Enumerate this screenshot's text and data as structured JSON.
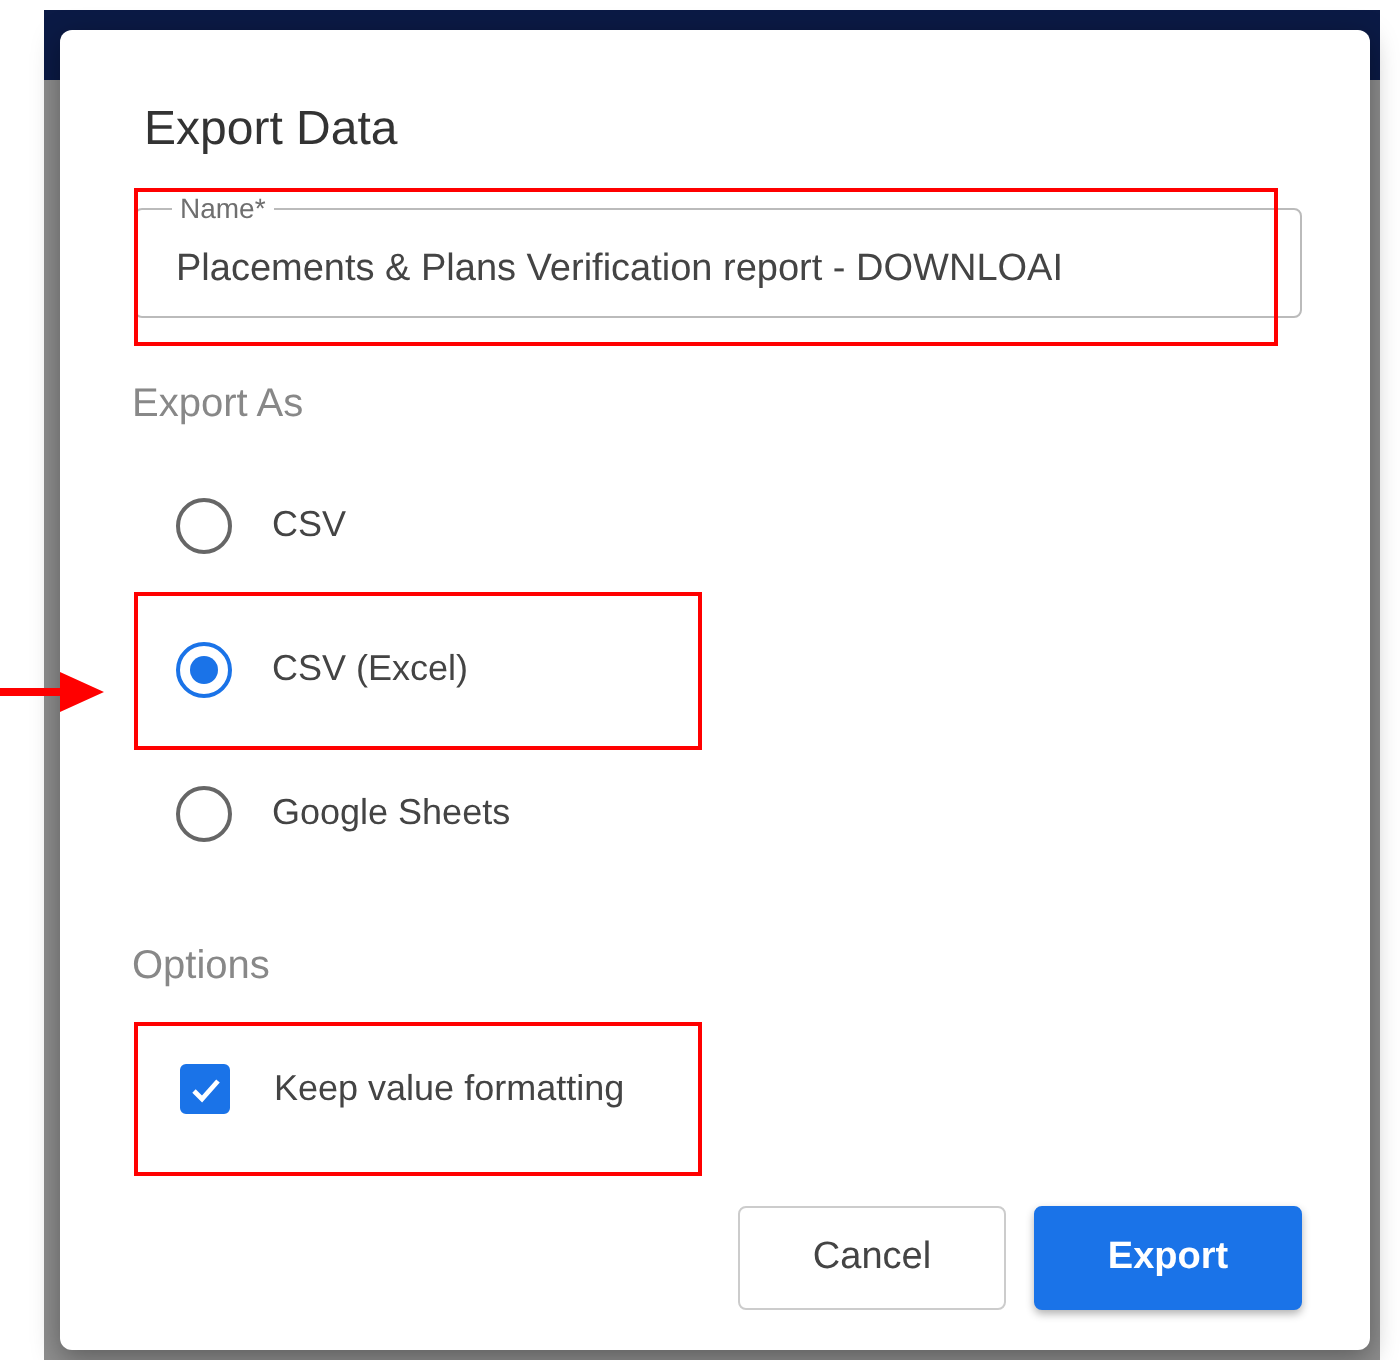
{
  "dialog": {
    "title": "Export Data",
    "name_field": {
      "label": "Name*",
      "value": "Placements & Plans Verification report - DOWNLOAI"
    },
    "export_as": {
      "heading": "Export As",
      "options": [
        {
          "label": "CSV",
          "selected": false
        },
        {
          "label": "CSV (Excel)",
          "selected": true
        },
        {
          "label": "Google Sheets",
          "selected": false
        }
      ]
    },
    "options": {
      "heading": "Options",
      "items": [
        {
          "label": "Keep value formatting",
          "checked": true
        }
      ]
    },
    "buttons": [
      {
        "label": "Cancel",
        "kind": "secondary"
      },
      {
        "label": "Export",
        "kind": "primary"
      }
    ]
  }
}
